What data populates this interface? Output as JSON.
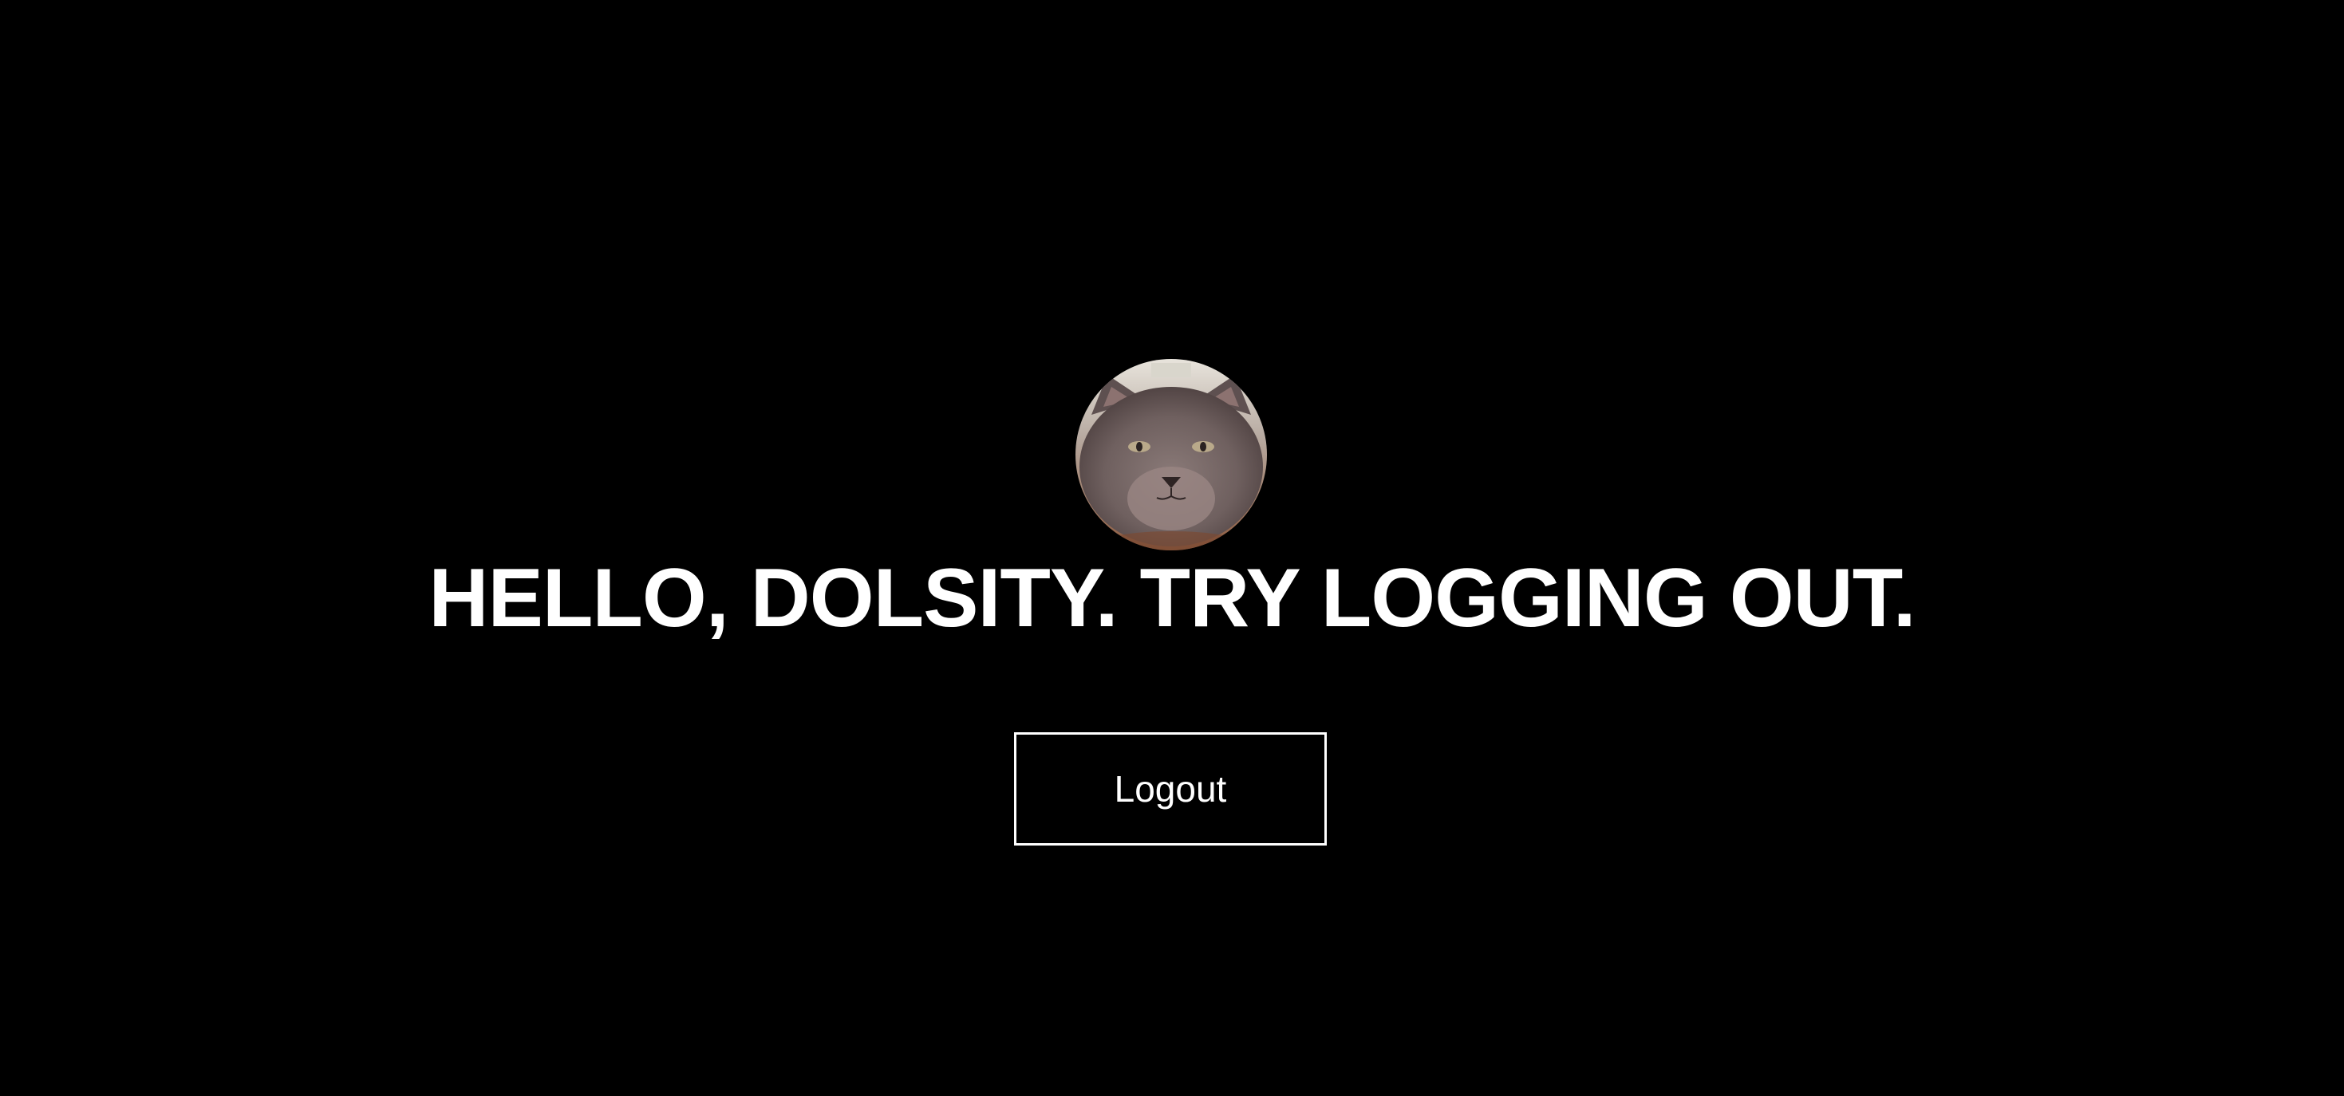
{
  "profile": {
    "avatar_icon": "cat-avatar",
    "greeting": "HELLO, DOLSITY. TRY LOGGING OUT."
  },
  "actions": {
    "logout_label": "Logout"
  },
  "colors": {
    "background": "#000000",
    "text": "#ffffff",
    "button_border": "#ffffff"
  }
}
